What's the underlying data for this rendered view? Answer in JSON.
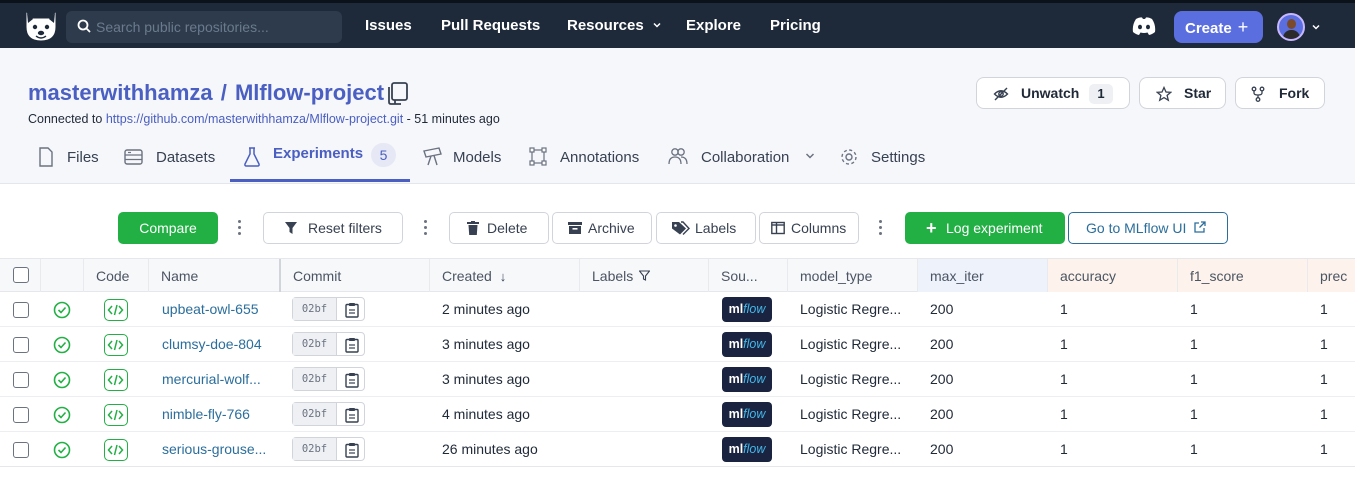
{
  "nav": {
    "search_placeholder": "Search public repositories...",
    "links": [
      "Issues",
      "Pull Requests",
      "Resources",
      "Explore",
      "Pricing"
    ],
    "create_label": "Create"
  },
  "repo": {
    "owner": "masterwithhamza",
    "name": "Mlflow-project",
    "connected_prefix": "Connected to",
    "connected_url": "https://github.com/masterwithhamza/Mlflow-project.git",
    "connected_suffix": "- 51 minutes ago",
    "unwatch_label": "Unwatch",
    "unwatch_count": "1",
    "star_label": "Star",
    "fork_label": "Fork"
  },
  "tabs": [
    {
      "label": "Files"
    },
    {
      "label": "Datasets"
    },
    {
      "label": "Experiments",
      "count": "5"
    },
    {
      "label": "Models"
    },
    {
      "label": "Annotations"
    },
    {
      "label": "Collaboration"
    },
    {
      "label": "Settings"
    }
  ],
  "toolbar": {
    "compare": "Compare",
    "reset_filters": "Reset filters",
    "delete": "Delete",
    "archive": "Archive",
    "labels": "Labels",
    "columns": "Columns",
    "log_experiment": "Log experiment",
    "mlflow_ui": "Go to MLflow UI"
  },
  "table": {
    "headers": [
      "Code",
      "Name",
      "Commit",
      "Created",
      "Labels",
      "Sou...",
      "model_type",
      "max_iter",
      "accuracy",
      "f1_score",
      "prec"
    ],
    "rows": [
      {
        "name": "upbeat-owl-655",
        "commit": "02bf",
        "created": "2 minutes ago",
        "source_a": "ml",
        "source_b": "flow",
        "model_type": "Logistic Regre...",
        "max_iter": "200",
        "accuracy": "1",
        "f1_score": "1",
        "precision": "1"
      },
      {
        "name": "clumsy-doe-804",
        "commit": "02bf",
        "created": "3 minutes ago",
        "source_a": "ml",
        "source_b": "flow",
        "model_type": "Logistic Regre...",
        "max_iter": "200",
        "accuracy": "1",
        "f1_score": "1",
        "precision": "1"
      },
      {
        "name": "mercurial-wolf...",
        "commit": "02bf",
        "created": "3 minutes ago",
        "source_a": "ml",
        "source_b": "flow",
        "model_type": "Logistic Regre...",
        "max_iter": "200",
        "accuracy": "1",
        "f1_score": "1",
        "precision": "1"
      },
      {
        "name": "nimble-fly-766",
        "commit": "02bf",
        "created": "4 minutes ago",
        "source_a": "ml",
        "source_b": "flow",
        "model_type": "Logistic Regre...",
        "max_iter": "200",
        "accuracy": "1",
        "f1_score": "1",
        "precision": "1"
      },
      {
        "name": "serious-grouse...",
        "commit": "02bf",
        "created": "26 minutes ago",
        "source_a": "ml",
        "source_b": "flow",
        "model_type": "Logistic Regre...",
        "max_iter": "200",
        "accuracy": "1",
        "f1_score": "1",
        "precision": "1"
      }
    ]
  },
  "colors": {
    "nav_bg": "#1e2a3a",
    "accent": "#4a5fc1",
    "success": "#22b045",
    "link": "#2b6e9c"
  }
}
